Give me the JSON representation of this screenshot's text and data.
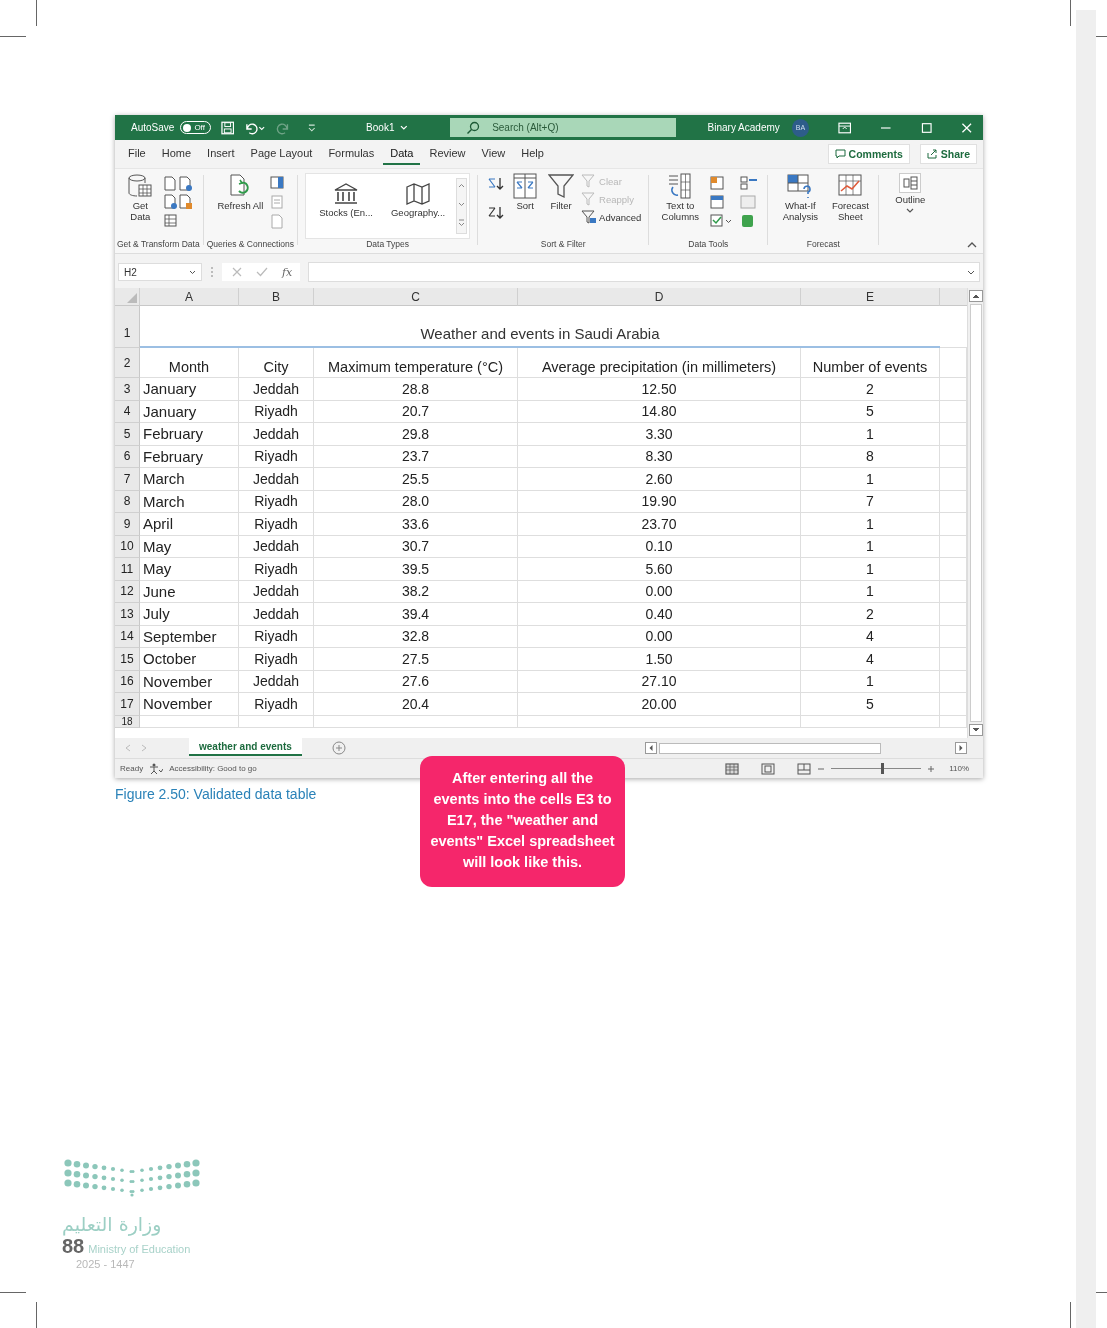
{
  "excel": {
    "title_bar": {
      "autosave": "AutoSave",
      "autosave_toggle": {
        "label": "Off",
        "on": false
      },
      "book": "Book1",
      "search_placeholder": "Search (Alt+Q)",
      "user": "Binary Academy",
      "avatar": "BA"
    },
    "tabs": [
      {
        "label": "File",
        "selected": false
      },
      {
        "label": "Home",
        "selected": false
      },
      {
        "label": "Insert",
        "selected": false
      },
      {
        "label": "Page Layout",
        "selected": false
      },
      {
        "label": "Formulas",
        "selected": false
      },
      {
        "label": "Data",
        "selected": true
      },
      {
        "label": "Review",
        "selected": false
      },
      {
        "label": "View",
        "selected": false
      },
      {
        "label": "Help",
        "selected": false
      }
    ],
    "comments": "Comments",
    "share": "Share",
    "ribbon": {
      "get_transform": {
        "title": "Get & Transform Data",
        "button": "Get Data"
      },
      "queries": {
        "title": "Queries & Connections",
        "button": "Refresh All"
      },
      "data_types": {
        "title": "Data Types",
        "items": [
          "Stocks (En...",
          "Geography..."
        ]
      },
      "sort_filter": {
        "title": "Sort & Filter",
        "sort": "Sort",
        "filter": "Filter",
        "options": [
          {
            "label": "Clear",
            "disabled": true
          },
          {
            "label": "Reapply",
            "disabled": true
          },
          {
            "label": "Advanced",
            "disabled": false
          }
        ]
      },
      "data_tools": {
        "title": "Data Tools",
        "button": "Text to Columns"
      },
      "forecast": {
        "title": "Forecast",
        "buttons": [
          "What-If Analysis",
          "Forecast Sheet"
        ]
      },
      "outline": "Outline"
    },
    "name_box": "H2",
    "function_label": "fx",
    "columns": [
      "A",
      "B",
      "C",
      "D",
      "E"
    ],
    "title_row": {
      "row_number": "1",
      "text": "Weather and events in Saudi Arabia"
    },
    "header_row": {
      "row_number": "2",
      "cells": [
        "Month",
        "City",
        "Maximum temperature (°C)",
        "Average precipitation (in millimeters)",
        "Number of events"
      ]
    },
    "rows": [
      {
        "row_number": "3",
        "month": "January",
        "city": "Jeddah",
        "max_temp": "28.8",
        "precipitation": "12.50",
        "events": "2"
      },
      {
        "row_number": "4",
        "month": "January",
        "city": "Riyadh",
        "max_temp": "20.7",
        "precipitation": "14.80",
        "events": "5"
      },
      {
        "row_number": "5",
        "month": "February",
        "city": "Jeddah",
        "max_temp": "29.8",
        "precipitation": "3.30",
        "events": "1"
      },
      {
        "row_number": "6",
        "month": "February",
        "city": "Riyadh",
        "max_temp": "23.7",
        "precipitation": "8.30",
        "events": "8"
      },
      {
        "row_number": "7",
        "month": "March",
        "city": "Jeddah",
        "max_temp": "25.5",
        "precipitation": "2.60",
        "events": "1"
      },
      {
        "row_number": "8",
        "month": "March",
        "city": "Riyadh",
        "max_temp": "28.0",
        "precipitation": "19.90",
        "events": "7"
      },
      {
        "row_number": "9",
        "month": "April",
        "city": "Riyadh",
        "max_temp": "33.6",
        "precipitation": "23.70",
        "events": "1"
      },
      {
        "row_number": "10",
        "month": "May",
        "city": "Jeddah",
        "max_temp": "30.7",
        "precipitation": "0.10",
        "events": "1"
      },
      {
        "row_number": "11",
        "month": "May",
        "city": "Riyadh",
        "max_temp": "39.5",
        "precipitation": "5.60",
        "events": "1"
      },
      {
        "row_number": "12",
        "month": "June",
        "city": "Jeddah",
        "max_temp": "38.2",
        "precipitation": "0.00",
        "events": "1"
      },
      {
        "row_number": "13",
        "month": "July",
        "city": "Jeddah",
        "max_temp": "39.4",
        "precipitation": "0.40",
        "events": "2"
      },
      {
        "row_number": "14",
        "month": "September",
        "city": "Riyadh",
        "max_temp": "32.8",
        "precipitation": "0.00",
        "events": "4"
      },
      {
        "row_number": "15",
        "month": "October",
        "city": "Riyadh",
        "max_temp": "27.5",
        "precipitation": "1.50",
        "events": "4"
      },
      {
        "row_number": "16",
        "month": "November",
        "city": "Jeddah",
        "max_temp": "27.6",
        "precipitation": "27.10",
        "events": "1"
      },
      {
        "row_number": "17",
        "month": "November",
        "city": "Riyadh",
        "max_temp": "20.4",
        "precipitation": "20.00",
        "events": "5"
      }
    ],
    "last_row_number": "18",
    "sheet_tabs": [
      {
        "label": "weather and events",
        "selected": true
      }
    ],
    "status_bar": {
      "ready": "Ready",
      "accessibility": "Accessibility: Good to go",
      "zoom": {
        "level": 0.57,
        "reading": "110%"
      }
    }
  },
  "caption": "Figure 2.50: Validated data table",
  "callout": "After entering all the events into the cells E3 to E17, the \"weather and events\" Excel spreadsheet will look like this.",
  "footer": {
    "ministry_arabic": "وزارة التعليم",
    "ministry_english": "Ministry of Education",
    "years": "2025 - 1447",
    "page_number": "88"
  }
}
